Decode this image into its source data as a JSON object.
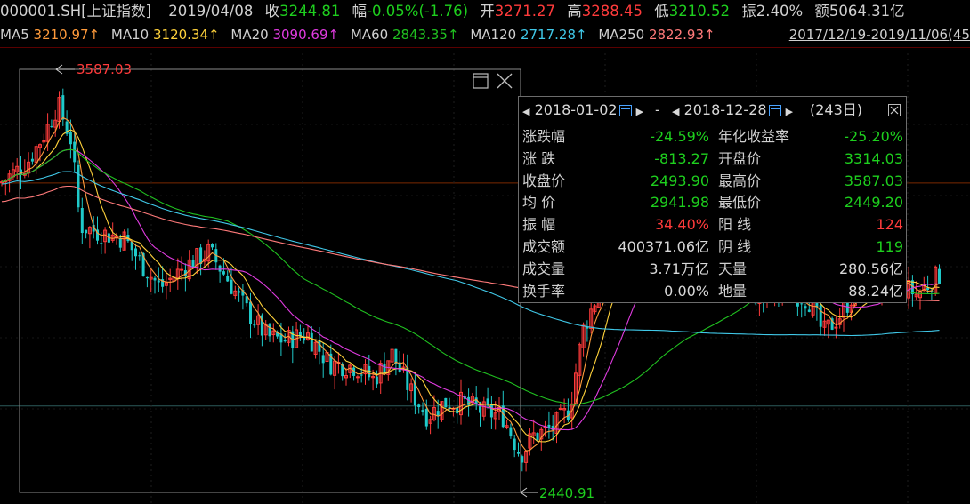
{
  "header": {
    "symbol": "000001.SH[上证指数]",
    "date": "2019/04/08",
    "close_label": "收",
    "close_value": "3244.81",
    "change_label": "幅",
    "change_value": "-0.05%(-1.76)",
    "open_label": "开",
    "open_value": "3271.27",
    "high_label": "高",
    "high_value": "3288.45",
    "low_label": "低",
    "low_value": "3210.52",
    "amplitude_label": "振",
    "amplitude_value": "2.40%",
    "amount_label": "额",
    "amount_value": "5064.31亿"
  },
  "ma_bar": {
    "items": [
      {
        "name": "MA5",
        "value": "3210.97↑",
        "color": "#ff9b3b"
      },
      {
        "name": "MA10",
        "value": "3120.34↑",
        "color": "#ffd23b"
      },
      {
        "name": "MA20",
        "value": "3090.69↑",
        "color": "#e03be0"
      },
      {
        "name": "MA60",
        "value": "2843.35↑",
        "color": "#20c020"
      },
      {
        "name": "MA120",
        "value": "2717.28↑",
        "color": "#40c8e8"
      },
      {
        "name": "MA250",
        "value": "2822.93↑",
        "color": "#ff7a7a"
      }
    ],
    "range": "2017/12/19-2019/11/06(45"
  },
  "colors": {
    "up": "#ff3b3b",
    "down": "#1ecf1e",
    "background": "#000000",
    "frame": "#8a8a8a"
  },
  "chart_data": {
    "type": "candlestick",
    "ylim": [
      2350,
      3700
    ],
    "price_lines": [
      3310,
      2630
    ],
    "high_marker": "3587.03",
    "low_marker": "2440.91",
    "close_series": [
      {
        "x": 0,
        "y": 3310
      },
      {
        "x": 30,
        "y": 3370
      },
      {
        "x": 50,
        "y": 3460
      },
      {
        "x": 65,
        "y": 3550
      },
      {
        "x": 80,
        "y": 3440
      },
      {
        "x": 90,
        "y": 3180
      },
      {
        "x": 110,
        "y": 3160
      },
      {
        "x": 140,
        "y": 3140
      },
      {
        "x": 160,
        "y": 3060
      },
      {
        "x": 180,
        "y": 2990
      },
      {
        "x": 210,
        "y": 3060
      },
      {
        "x": 235,
        "y": 3100
      },
      {
        "x": 255,
        "y": 3020
      },
      {
        "x": 275,
        "y": 2930
      },
      {
        "x": 300,
        "y": 2840
      },
      {
        "x": 320,
        "y": 2830
      },
      {
        "x": 345,
        "y": 2850
      },
      {
        "x": 370,
        "y": 2760
      },
      {
        "x": 400,
        "y": 2750
      },
      {
        "x": 420,
        "y": 2710
      },
      {
        "x": 440,
        "y": 2790
      },
      {
        "x": 460,
        "y": 2680
      },
      {
        "x": 480,
        "y": 2600
      },
      {
        "x": 500,
        "y": 2640
      },
      {
        "x": 520,
        "y": 2640
      },
      {
        "x": 545,
        "y": 2610
      },
      {
        "x": 565,
        "y": 2600
      },
      {
        "x": 585,
        "y": 2480
      },
      {
        "x": 600,
        "y": 2540
      },
      {
        "x": 620,
        "y": 2560
      },
      {
        "x": 640,
        "y": 2620
      },
      {
        "x": 655,
        "y": 2860
      },
      {
        "x": 670,
        "y": 2960
      },
      {
        "x": 690,
        "y": 3090
      },
      {
        "x": 710,
        "y": 3190
      },
      {
        "x": 740,
        "y": 3220
      },
      {
        "x": 780,
        "y": 3020
      },
      {
        "x": 820,
        "y": 2990
      },
      {
        "x": 860,
        "y": 2960
      },
      {
        "x": 880,
        "y": 2990
      },
      {
        "x": 910,
        "y": 2950
      },
      {
        "x": 925,
        "y": 2850
      },
      {
        "x": 945,
        "y": 2910
      },
      {
        "x": 965,
        "y": 3000
      },
      {
        "x": 985,
        "y": 3000
      },
      {
        "x": 1005,
        "y": 3010
      },
      {
        "x": 1030,
        "y": 2970
      },
      {
        "x": 1055,
        "y": 3030
      }
    ]
  },
  "stats": {
    "start_date": "2018-01-02",
    "end_date": "2018-12-28",
    "separator": "-",
    "days": "(243日)",
    "rows": [
      {
        "l1": "涨跌幅",
        "v1": "-24.59%",
        "c1": "down",
        "l2": "年化收益率",
        "v2": "-25.20%",
        "c2": "down"
      },
      {
        "l1": "涨 跌",
        "v1": "-813.27",
        "c1": "down",
        "l2": "开盘价",
        "v2": "3314.03",
        "c2": "down"
      },
      {
        "l1": "收盘价",
        "v1": "2493.90",
        "c1": "down",
        "l2": "最高价",
        "v2": "3587.03",
        "c2": "down"
      },
      {
        "l1": "均 价",
        "v1": "2941.98",
        "c1": "down",
        "l2": "最低价",
        "v2": "2449.20",
        "c2": "down"
      },
      {
        "l1": "振 幅",
        "v1": "34.40%",
        "c1": "up",
        "l2": "阳 线",
        "v2": "124",
        "c2": "up"
      },
      {
        "l1": "成交额",
        "v1": "400371.06亿",
        "c1": "white",
        "l2": "阴 线",
        "v2": "119",
        "c2": "down"
      },
      {
        "l1": "成交量",
        "v1": "3.71万亿",
        "c1": "white",
        "l2": "天量",
        "v2": "280.56亿",
        "c2": "white"
      },
      {
        "l1": "换手率",
        "v1": "0.00%",
        "c1": "white",
        "l2": "地量",
        "v2": "88.24亿",
        "c2": "white"
      }
    ]
  }
}
